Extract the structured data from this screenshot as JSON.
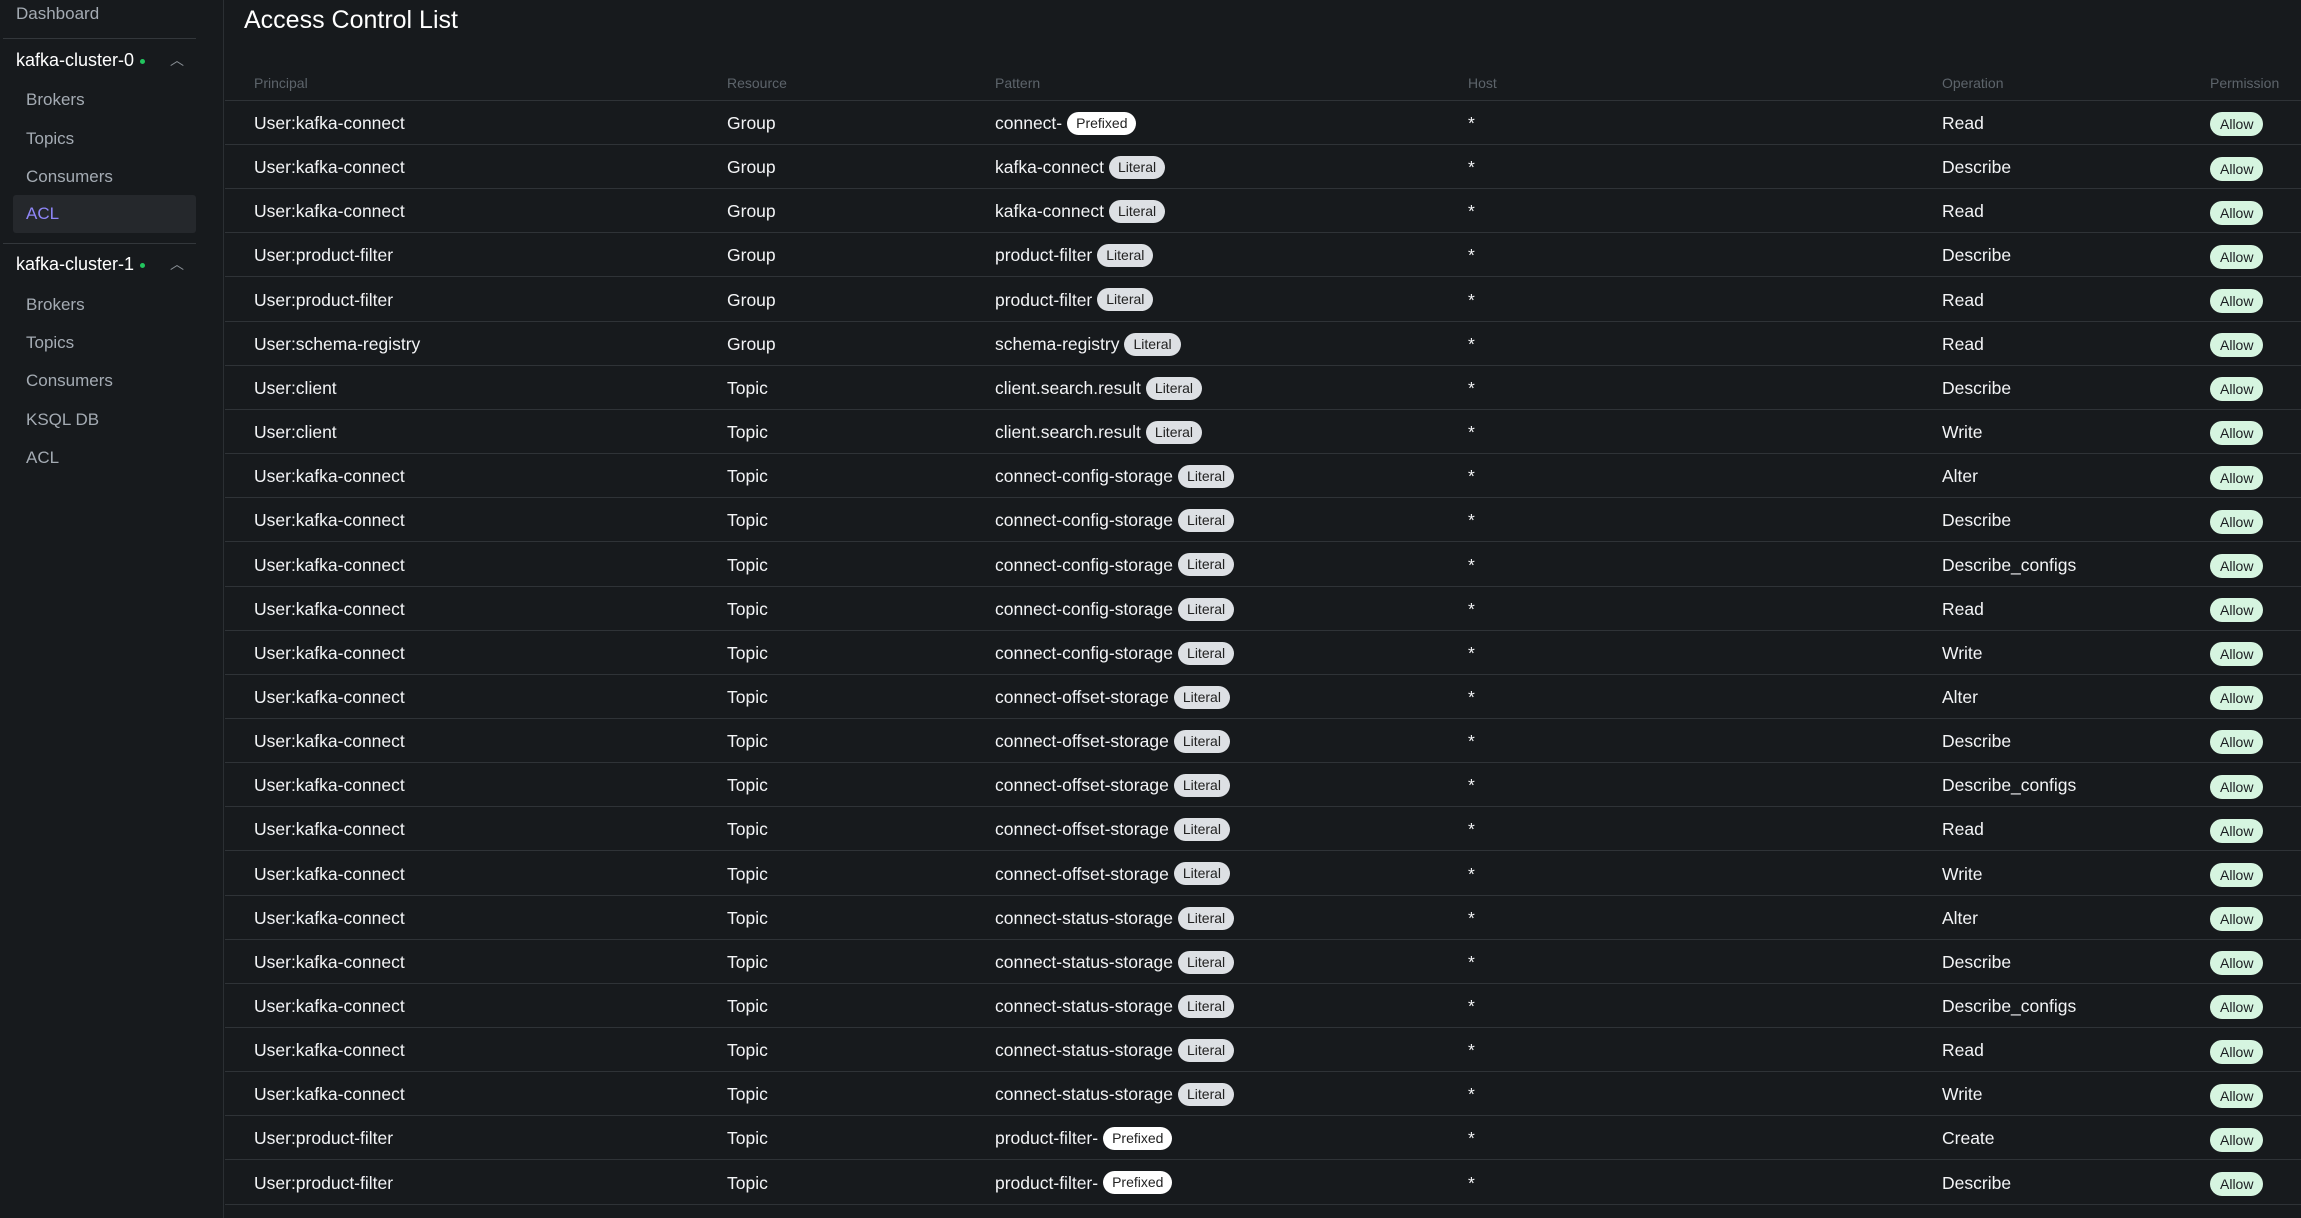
{
  "sidebar": {
    "dashboard": "Dashboard",
    "clusters": [
      {
        "name": "kafka-cluster-0",
        "items": [
          "Brokers",
          "Topics",
          "Consumers",
          "ACL"
        ]
      },
      {
        "name": "kafka-cluster-1",
        "items": [
          "Brokers",
          "Topics",
          "Consumers",
          "KSQL DB",
          "ACL"
        ]
      }
    ]
  },
  "page_title": "Access Control List",
  "columns": [
    "Principal",
    "Resource",
    "Pattern",
    "Host",
    "Operation",
    "Permission"
  ],
  "colors": {
    "accent": "#8f86f7",
    "allow": "#d6f5e0",
    "online": "#22c55e"
  },
  "rows": [
    [
      "User:kafka-connect",
      "Group",
      "connect-",
      "Prefixed",
      "*",
      "Read",
      "Allow"
    ],
    [
      "User:kafka-connect",
      "Group",
      "kafka-connect",
      "Literal",
      "*",
      "Describe",
      "Allow"
    ],
    [
      "User:kafka-connect",
      "Group",
      "kafka-connect",
      "Literal",
      "*",
      "Read",
      "Allow"
    ],
    [
      "User:product-filter",
      "Group",
      "product-filter",
      "Literal",
      "*",
      "Describe",
      "Allow"
    ],
    [
      "User:product-filter",
      "Group",
      "product-filter",
      "Literal",
      "*",
      "Read",
      "Allow"
    ],
    [
      "User:schema-registry",
      "Group",
      "schema-registry",
      "Literal",
      "*",
      "Read",
      "Allow"
    ],
    [
      "User:client",
      "Topic",
      "client.search.result",
      "Literal",
      "*",
      "Describe",
      "Allow"
    ],
    [
      "User:client",
      "Topic",
      "client.search.result",
      "Literal",
      "*",
      "Write",
      "Allow"
    ],
    [
      "User:kafka-connect",
      "Topic",
      "connect-config-storage",
      "Literal",
      "*",
      "Alter",
      "Allow"
    ],
    [
      "User:kafka-connect",
      "Topic",
      "connect-config-storage",
      "Literal",
      "*",
      "Describe",
      "Allow"
    ],
    [
      "User:kafka-connect",
      "Topic",
      "connect-config-storage",
      "Literal",
      "*",
      "Describe_configs",
      "Allow"
    ],
    [
      "User:kafka-connect",
      "Topic",
      "connect-config-storage",
      "Literal",
      "*",
      "Read",
      "Allow"
    ],
    [
      "User:kafka-connect",
      "Topic",
      "connect-config-storage",
      "Literal",
      "*",
      "Write",
      "Allow"
    ],
    [
      "User:kafka-connect",
      "Topic",
      "connect-offset-storage",
      "Literal",
      "*",
      "Alter",
      "Allow"
    ],
    [
      "User:kafka-connect",
      "Topic",
      "connect-offset-storage",
      "Literal",
      "*",
      "Describe",
      "Allow"
    ],
    [
      "User:kafka-connect",
      "Topic",
      "connect-offset-storage",
      "Literal",
      "*",
      "Describe_configs",
      "Allow"
    ],
    [
      "User:kafka-connect",
      "Topic",
      "connect-offset-storage",
      "Literal",
      "*",
      "Read",
      "Allow"
    ],
    [
      "User:kafka-connect",
      "Topic",
      "connect-offset-storage",
      "Literal",
      "*",
      "Write",
      "Allow"
    ],
    [
      "User:kafka-connect",
      "Topic",
      "connect-status-storage",
      "Literal",
      "*",
      "Alter",
      "Allow"
    ],
    [
      "User:kafka-connect",
      "Topic",
      "connect-status-storage",
      "Literal",
      "*",
      "Describe",
      "Allow"
    ],
    [
      "User:kafka-connect",
      "Topic",
      "connect-status-storage",
      "Literal",
      "*",
      "Describe_configs",
      "Allow"
    ],
    [
      "User:kafka-connect",
      "Topic",
      "connect-status-storage",
      "Literal",
      "*",
      "Read",
      "Allow"
    ],
    [
      "User:kafka-connect",
      "Topic",
      "connect-status-storage",
      "Literal",
      "*",
      "Write",
      "Allow"
    ],
    [
      "User:product-filter",
      "Topic",
      "product-filter-",
      "Prefixed",
      "*",
      "Create",
      "Allow"
    ],
    [
      "User:product-filter",
      "Topic",
      "product-filter-",
      "Prefixed",
      "*",
      "Describe",
      "Allow"
    ]
  ]
}
